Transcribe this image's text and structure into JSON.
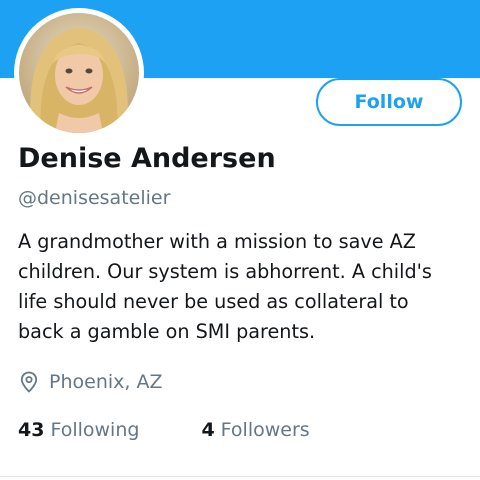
{
  "profile": {
    "name": "Denise Andersen",
    "handle": "@denisesatelier",
    "bio_lines": [
      "A grandmother with a mission to save AZ",
      "children. Our system is abhorrent. A child's",
      "life should never be used as collateral to",
      "back a gamble on SMI parents."
    ],
    "location": "Phoenix, AZ",
    "following_count": "43",
    "following_label": "Following",
    "followers_count": "4",
    "followers_label": "Followers"
  },
  "actions": {
    "follow_label": "Follow"
  },
  "colors": {
    "accent": "#1da1f2",
    "banner": "#1da1f2",
    "secondary_text": "#657786",
    "primary_text": "#14171a"
  },
  "icons": {
    "location": "location-pin-icon"
  }
}
